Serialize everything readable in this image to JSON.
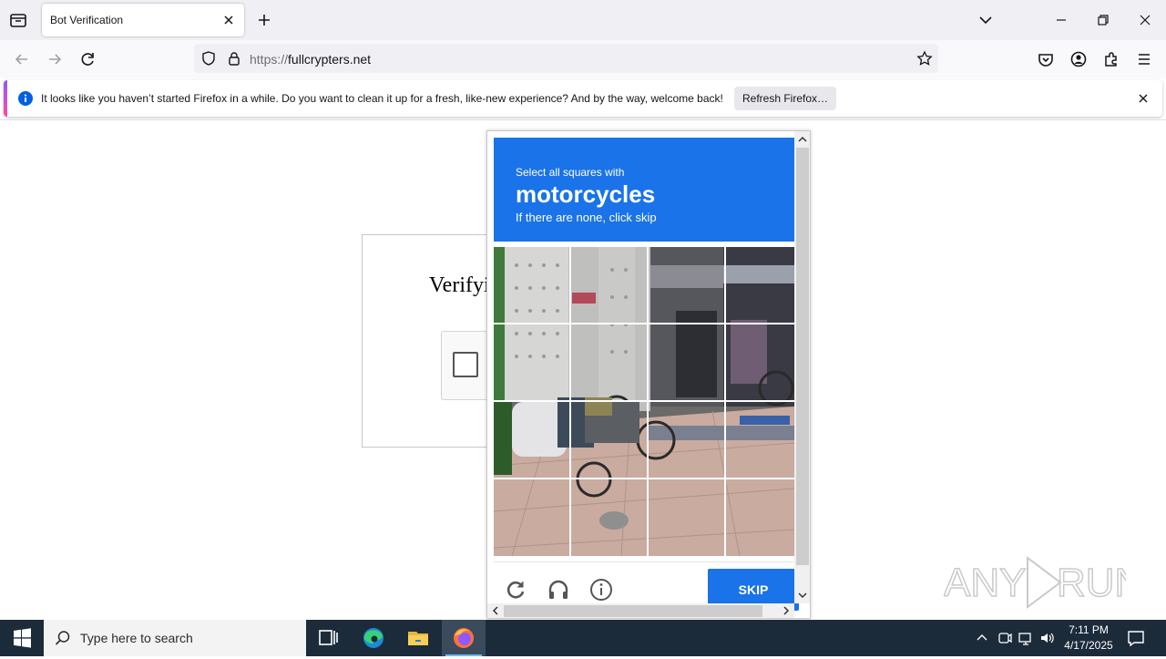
{
  "browser": {
    "tab": {
      "title": "Bot Verification"
    },
    "url": {
      "scheme": "https://",
      "host": "fullcrypters.net"
    }
  },
  "notification": {
    "message": "It looks like you haven’t started Firefox in a while. Do you want to clean it up for a fresh, like-new experience? And by the way, welcome back!",
    "button_label": "Refresh Firefox…"
  },
  "page": {
    "heading": "Verifyi"
  },
  "captcha": {
    "instruction_small": "Select all squares with",
    "target": "motorcycles",
    "instruction_sub": "If there are none, click skip",
    "skip_label": "SKIP",
    "grid": {
      "rows": 4,
      "cols": 4
    }
  },
  "watermark": {
    "text": "ANY RUN"
  },
  "taskbar": {
    "search_placeholder": "Type here to search",
    "time": "7:11 PM",
    "date": "4/17/2025"
  },
  "colors": {
    "captcha_blue": "#1a73e8",
    "taskbar": "#1c2b3a",
    "firefox_accent": "#9059ff"
  }
}
